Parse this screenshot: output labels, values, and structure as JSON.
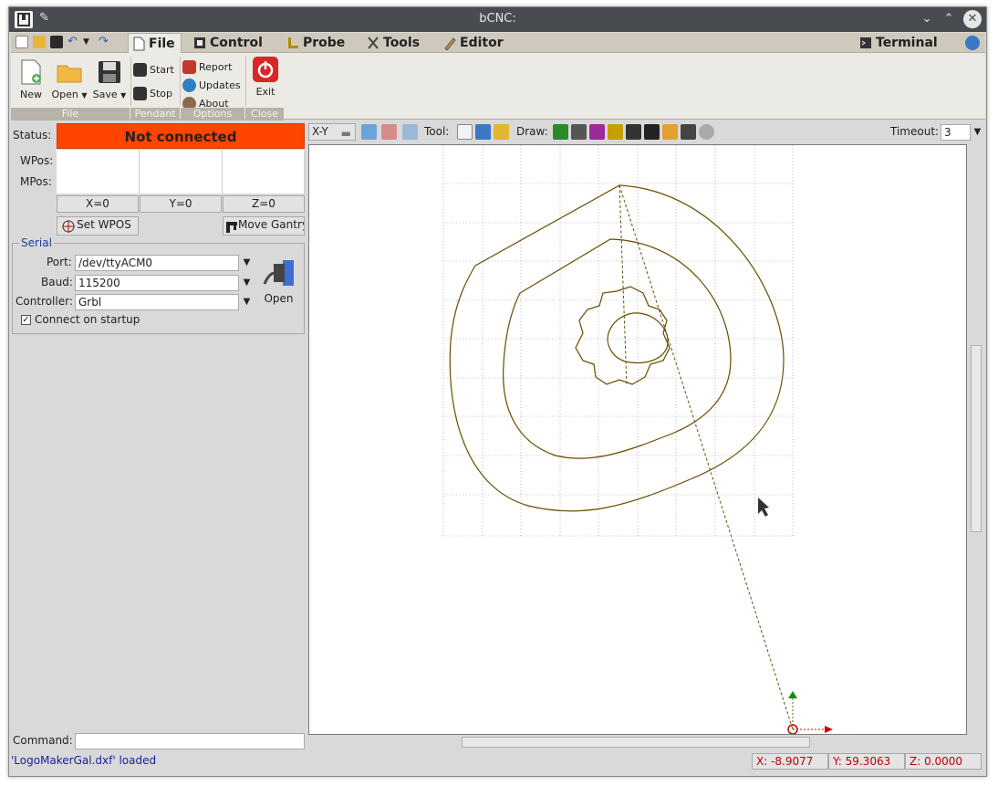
{
  "window": {
    "title": "bCNC:"
  },
  "tabs": [
    {
      "label": "File",
      "active": true
    },
    {
      "label": "Control"
    },
    {
      "label": "Probe"
    },
    {
      "label": "Tools"
    },
    {
      "label": "Editor"
    },
    {
      "label": "Terminal"
    }
  ],
  "ribbon": {
    "file": {
      "new": "New",
      "open": "Open",
      "save": "Save",
      "group": "File"
    },
    "pendant": {
      "start": "Start",
      "stop": "Stop",
      "group": "Pendant"
    },
    "options": {
      "report": "Report",
      "updates": "Updates",
      "about": "About",
      "group": "Options"
    },
    "close": {
      "exit": "Exit",
      "group": "Close"
    }
  },
  "status": {
    "label": "Status:",
    "value": "Not connected",
    "color": "#ff4500"
  },
  "positions": {
    "wpos_label": "WPos:",
    "mpos_label": "MPos:",
    "zero_x": "X=0",
    "zero_y": "Y=0",
    "zero_z": "Z=0",
    "set_wpos": "Set WPOS",
    "move_gantry": "Move Gantry"
  },
  "serial": {
    "title": "Serial",
    "port_label": "Port:",
    "port_value": "/dev/ttyACM0",
    "baud_label": "Baud:",
    "baud_value": "115200",
    "controller_label": "Controller:",
    "controller_value": "Grbl",
    "open_label": "Open",
    "connect_startup_label": "Connect on startup",
    "connect_startup_checked": true
  },
  "canvas_toolbar": {
    "view": "X-Y",
    "tool_label": "Tool:",
    "draw_label": "Draw:",
    "timeout_label": "Timeout:",
    "timeout_value": "3"
  },
  "command": {
    "label": "Command:",
    "value": ""
  },
  "statusbar": {
    "message": "'LogoMakerGal.dxf' loaded",
    "x": "X: -8.9077",
    "y": "Y: 59.3063",
    "z": "Z: 0.0000"
  },
  "colors": {
    "accent_blue": "#1f3f9b",
    "path_color": "#6b4a00",
    "axis_x": "#d40000",
    "axis_y": "#1a8a1a"
  }
}
